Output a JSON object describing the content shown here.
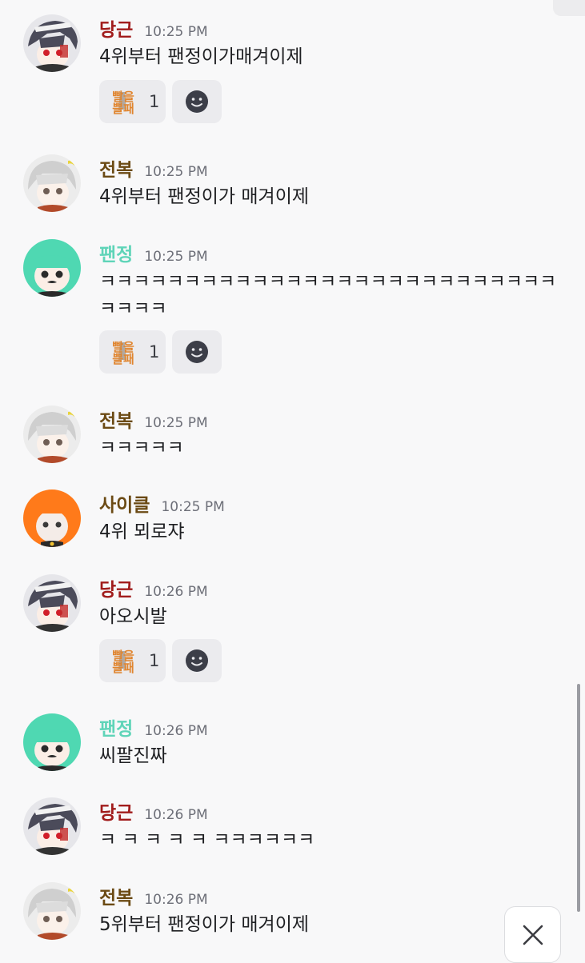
{
  "messages": [
    {
      "author": "당근",
      "time": "10:25 PM",
      "text": "4위부터 팬정이가매겨이제",
      "reaction_count": "1"
    },
    {
      "author": "전복",
      "time": "10:25 PM",
      "text": "4위부터 팬정이가 매겨이제"
    },
    {
      "author": "팬정",
      "time": "10:25 PM",
      "text": "ㅋㅋㅋㅋㅋㅋㅋㅋㅋㅋㅋㅋㅋㅋㅋㅋㅋㅋㅋㅋㅋㅋㅋㅋㅋㅋㅋ\nㅋㅋㅋㅋ",
      "reaction_count": "1"
    },
    {
      "author": "전복",
      "time": "10:25 PM",
      "text": "ㅋㅋㅋㅋㅋ"
    },
    {
      "author": "사이클",
      "time": "10:25 PM",
      "text": "4위 뫼로쟈"
    },
    {
      "author": "당근",
      "time": "10:26 PM",
      "text": "아오시발",
      "reaction_count": "1"
    },
    {
      "author": "팬정",
      "time": "10:26 PM",
      "text": "씨팔진짜"
    },
    {
      "author": "당근",
      "time": "10:26 PM",
      "text": "ㅋ ㅋ ㅋ ㅋ ㅋ ㅋㅋㅋㅋㅋㅋ"
    },
    {
      "author": "전복",
      "time": "10:26 PM",
      "text": "5위부터 팬정이가 매겨이제"
    }
  ],
  "reaction_emoji_text": "빨을 쁠패",
  "colors": {
    "dangeun": "#a11c1c",
    "jeonbok": "#6b4a14",
    "paenjeong": "#5fd4b8",
    "cycle": "#6b4a14",
    "background": "#f8f8f9",
    "reaction_bg": "#ebebee"
  },
  "icons": {
    "add_reaction": "smiley-icon",
    "close": "close-x-icon"
  }
}
